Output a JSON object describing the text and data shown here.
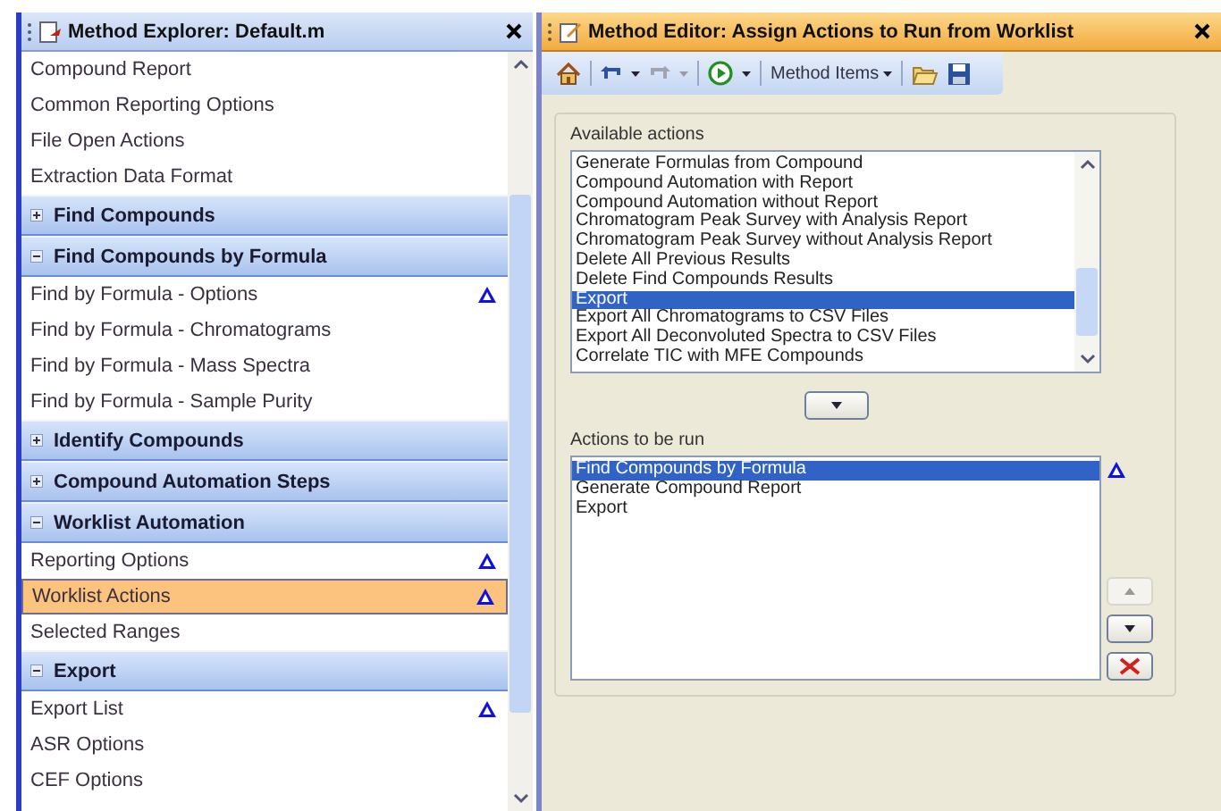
{
  "explorer": {
    "title": "Method Explorer: Default.m",
    "items": [
      {
        "kind": "item",
        "label": "Compound Report",
        "selected": false,
        "warning": false
      },
      {
        "kind": "item",
        "label": "Common Reporting Options",
        "selected": false,
        "warning": false
      },
      {
        "kind": "item",
        "label": "File Open Actions",
        "selected": false,
        "warning": false
      },
      {
        "kind": "item",
        "label": "Extraction Data Format",
        "selected": false,
        "warning": false
      },
      {
        "kind": "header",
        "label": "Find Compounds",
        "expanded": false
      },
      {
        "kind": "header",
        "label": "Find Compounds by Formula",
        "expanded": true
      },
      {
        "kind": "item",
        "label": "Find by Formula - Options",
        "selected": false,
        "warning": true
      },
      {
        "kind": "item",
        "label": "Find by Formula - Chromatograms",
        "selected": false,
        "warning": false
      },
      {
        "kind": "item",
        "label": "Find by Formula - Mass Spectra",
        "selected": false,
        "warning": false
      },
      {
        "kind": "item",
        "label": "Find by Formula - Sample Purity",
        "selected": false,
        "warning": false
      },
      {
        "kind": "header",
        "label": "Identify Compounds",
        "expanded": false
      },
      {
        "kind": "header",
        "label": "Compound Automation Steps",
        "expanded": false
      },
      {
        "kind": "header",
        "label": "Worklist Automation",
        "expanded": true
      },
      {
        "kind": "item",
        "label": "Reporting Options",
        "selected": false,
        "warning": true
      },
      {
        "kind": "item",
        "label": "Worklist Actions",
        "selected": true,
        "warning": true
      },
      {
        "kind": "item",
        "label": "Selected Ranges",
        "selected": false,
        "warning": false
      },
      {
        "kind": "header",
        "label": "Export",
        "expanded": true
      },
      {
        "kind": "item",
        "label": "Export List",
        "selected": false,
        "warning": true
      },
      {
        "kind": "item",
        "label": "ASR Options",
        "selected": false,
        "warning": false
      },
      {
        "kind": "item",
        "label": "CEF Options",
        "selected": false,
        "warning": false
      }
    ]
  },
  "editor": {
    "title": "Method Editor: Assign Actions to Run from Worklist",
    "toolbar": {
      "menu": "Method Items"
    },
    "available": {
      "label": "Available actions",
      "items": [
        {
          "label": "Generate Formulas from Compound",
          "selected": false
        },
        {
          "label": "Compound Automation with Report",
          "selected": false
        },
        {
          "label": "Compound Automation without Report",
          "selected": false
        },
        {
          "label": "Chromatogram Peak Survey with Analysis Report",
          "selected": false
        },
        {
          "label": "Chromatogram Peak Survey without Analysis Report",
          "selected": false
        },
        {
          "label": "Delete All Previous Results",
          "selected": false
        },
        {
          "label": "Delete Find Compounds Results",
          "selected": false
        },
        {
          "label": "Export",
          "selected": true
        },
        {
          "label": "Export All Chromatograms to CSV Files",
          "selected": false
        },
        {
          "label": "Export All Deconvoluted Spectra to CSV Files",
          "selected": false
        },
        {
          "label": "Correlate TIC with MFE Compounds",
          "selected": false
        }
      ]
    },
    "run": {
      "label": "Actions to be run",
      "warning": true,
      "items": [
        {
          "label": "Find Compounds by Formula",
          "selected": true
        },
        {
          "label": "Generate Compound Report",
          "selected": false
        },
        {
          "label": "Export",
          "selected": false
        }
      ]
    },
    "move_up": {
      "disabled": true
    },
    "move_down": {
      "disabled": false
    }
  }
}
